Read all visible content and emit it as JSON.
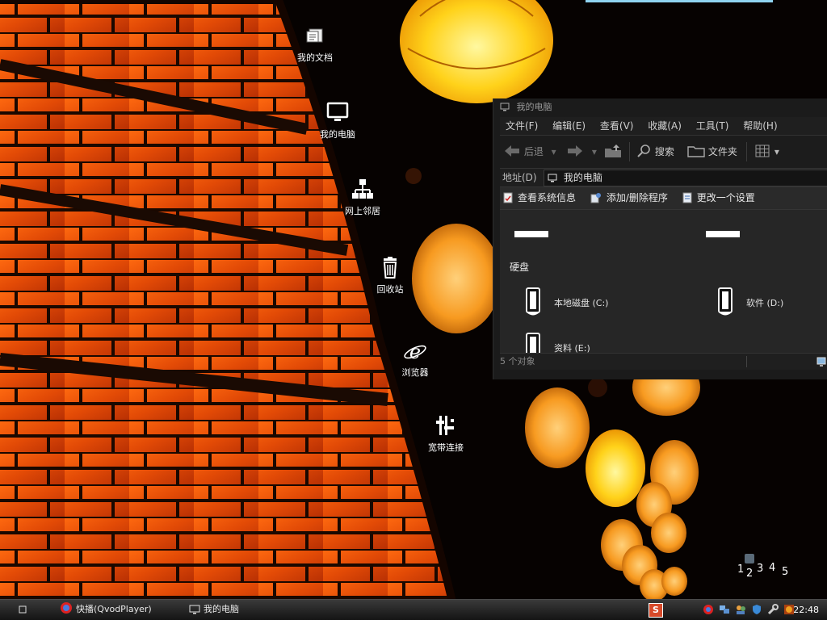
{
  "desktop": {
    "icons": [
      {
        "label": "我的文档",
        "icon": "documents-icon"
      },
      {
        "label": "我的电脑",
        "icon": "computer-icon"
      },
      {
        "label": "网上邻居",
        "icon": "network-icon"
      },
      {
        "label": "回收站",
        "icon": "recycle-bin-icon"
      },
      {
        "label": "浏览器",
        "icon": "ie-browser-icon"
      },
      {
        "label": "宽带连接",
        "icon": "broadband-icon"
      }
    ],
    "workspaces": [
      "1",
      "2",
      "3",
      "4",
      "5"
    ]
  },
  "window": {
    "title": "我的电脑",
    "menu": [
      "文件(F)",
      "编辑(E)",
      "查看(V)",
      "收藏(A)",
      "工具(T)",
      "帮助(H)"
    ],
    "toolbar": {
      "back": "后退",
      "search": "搜索",
      "folders": "文件夹"
    },
    "address": {
      "label": "地址(D)",
      "value": "我的电脑"
    },
    "tasks": [
      "查看系统信息",
      "添加/删除程序",
      "更改一个设置"
    ],
    "section": "硬盘",
    "drives": [
      {
        "label": "本地磁盘 (C:)"
      },
      {
        "label": "软件 (D:)"
      },
      {
        "label": "资料 (E:)"
      }
    ],
    "status": "5 个对象"
  },
  "taskbar": {
    "tasks": [
      {
        "label": "快播(QvodPlayer)",
        "icon": "qvod-icon"
      },
      {
        "label": "我的电脑",
        "icon": "computer-icon"
      }
    ],
    "clock": "22:48"
  }
}
